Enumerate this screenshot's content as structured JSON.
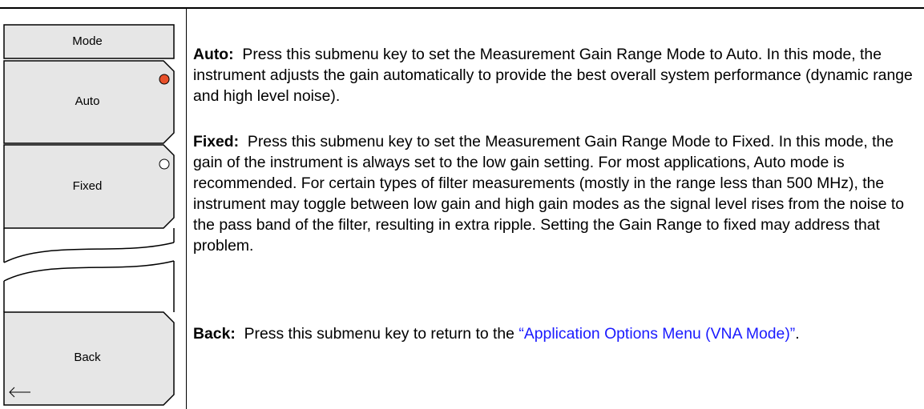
{
  "menu": {
    "title": "Mode",
    "keys": [
      {
        "label": "Auto",
        "selected": true
      },
      {
        "label": "Fixed",
        "selected": false
      },
      {
        "label": "Back",
        "icon": "back-arrow-icon"
      }
    ],
    "indicator_selected_color": "#e8502a"
  },
  "descriptions": [
    {
      "term": "Auto:",
      "text": "Press this submenu key to set the Measurement Gain Range Mode to Auto. In this mode, the instrument adjusts the gain automatically to provide the best overall system performance (dynamic range and high level noise)."
    },
    {
      "term": "Fixed:",
      "text": "Press this submenu key to set the Measurement Gain Range Mode to Fixed. In this mode, the gain of the instrument is always set to the low gain setting. For most applications, Auto mode is recommended. For certain types of filter measurements (mostly in the range less than 500 MHz), the instrument may toggle between low gain and high gain modes as the signal level rises from the noise to the pass band of the filter, resulting in extra ripple. Setting the Gain Range to fixed may address that problem."
    },
    {
      "term": "Back:",
      "text_before": "Press this submenu key to return to the ",
      "link": "“Application Options Menu (VNA Mode)”",
      "text_after": "."
    }
  ],
  "colors": {
    "link": "#1a1aff",
    "key_fill": "#e6e6e6"
  }
}
